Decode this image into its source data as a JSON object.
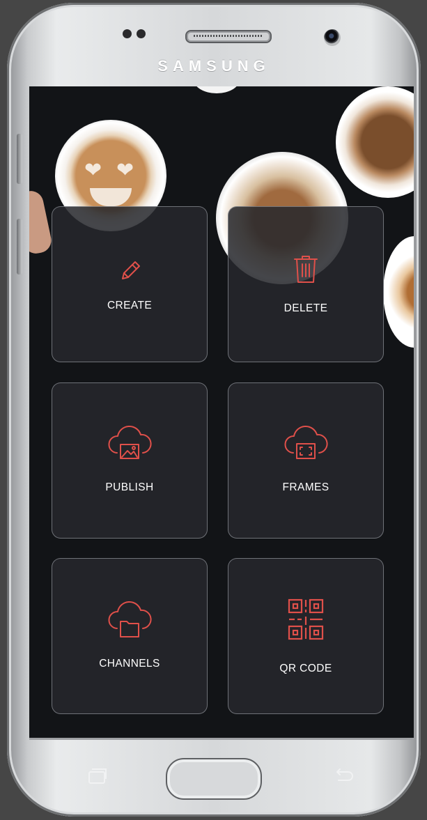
{
  "device": {
    "brand": "SAMSUNG"
  },
  "menu": {
    "tiles": [
      {
        "label": "CREATE",
        "icon": "pencil-icon"
      },
      {
        "label": "DELETE",
        "icon": "trash-icon"
      },
      {
        "label": "PUBLISH",
        "icon": "cloud-image-icon"
      },
      {
        "label": "FRAMES",
        "icon": "cloud-frame-icon"
      },
      {
        "label": "CHANNELS",
        "icon": "cloud-folder-icon"
      },
      {
        "label": "QR CODE",
        "icon": "qr-code-icon"
      }
    ]
  },
  "colors": {
    "accent": "#e0504a",
    "screen_bg": "#121417",
    "tile_bg": "#26282c",
    "label": "#ffffff"
  }
}
